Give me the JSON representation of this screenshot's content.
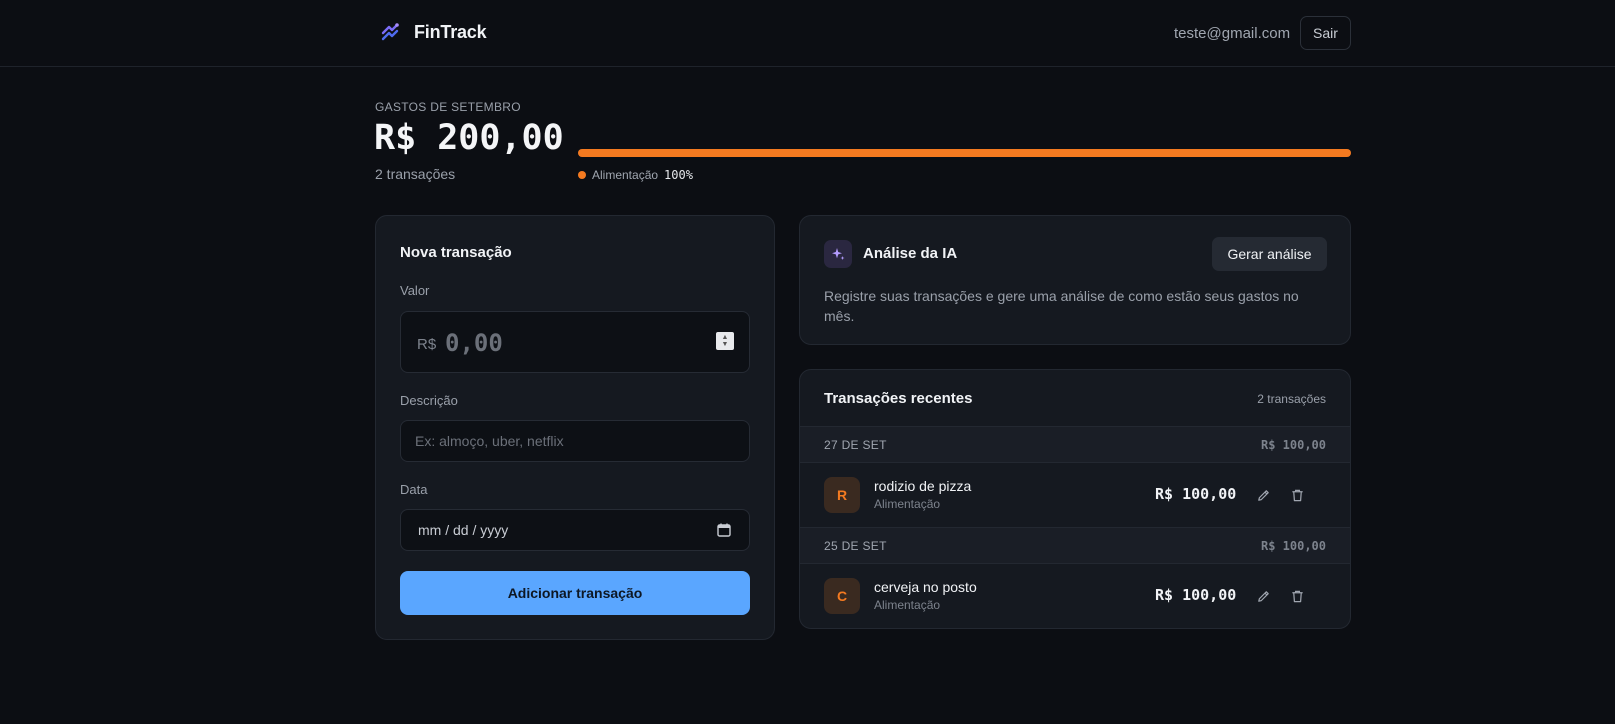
{
  "header": {
    "brand": "FinTrack",
    "user_email": "teste@gmail.com",
    "logout_label": "Sair"
  },
  "summary": {
    "label": "GASTOS DE SETEMBRO",
    "total": "R$ 200,00",
    "count": "2 transações",
    "progress": [
      {
        "category": "Alimentação",
        "percent_label": "100%",
        "percent": 100,
        "color": "#f47a20"
      }
    ]
  },
  "form": {
    "title": "Nova transação",
    "value_label": "Valor",
    "currency_prefix": "R$",
    "value_placeholder": "0,00",
    "description_label": "Descrição",
    "description_placeholder": "Ex: almoço, uber, netflix",
    "date_label": "Data",
    "date_placeholder": "mm / dd / yyyy",
    "submit_label": "Adicionar transação"
  },
  "ai": {
    "title": "Análise da IA",
    "button_label": "Gerar análise",
    "text": "Registre suas transações e gere uma análise de como estão seus gastos no mês."
  },
  "transactions": {
    "title": "Transações recentes",
    "count": "2 transações",
    "days": [
      {
        "label": "27 DE SET",
        "total": "R$ 100,00",
        "items": [
          {
            "initial": "R",
            "name": "rodizio de pizza",
            "category": "Alimentação",
            "amount": "R$ 100,00"
          }
        ]
      },
      {
        "label": "25 DE SET",
        "total": "R$ 100,00",
        "items": [
          {
            "initial": "C",
            "name": "cerveja no posto",
            "category": "Alimentação",
            "amount": "R$ 100,00"
          }
        ]
      }
    ]
  },
  "colors": {
    "accent": "#5aa6ff",
    "category_food": "#f47a20",
    "background": "#0c0e13"
  }
}
